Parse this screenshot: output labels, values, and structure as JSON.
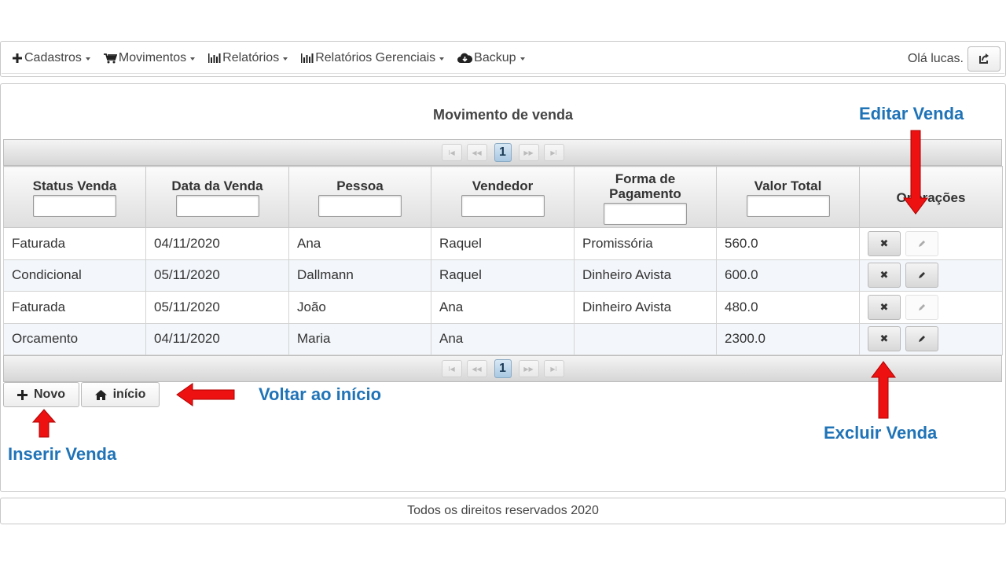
{
  "navbar": {
    "items": [
      {
        "label": "Cadastros",
        "icon": "plus-icon"
      },
      {
        "label": "Movimentos",
        "icon": "cart-icon"
      },
      {
        "label": "Relatórios",
        "icon": "bar-chart-icon"
      },
      {
        "label": "Relatórios Gerenciais",
        "icon": "bar-chart-icon"
      },
      {
        "label": "Backup",
        "icon": "cloud-download-icon"
      }
    ],
    "greeting": "Olá lucas.",
    "logout_icon": "share-exit-icon"
  },
  "page": {
    "title": "Movimento de venda"
  },
  "table": {
    "paginator": {
      "current_page": "1"
    },
    "columns": [
      "Status Venda",
      "Data da Venda",
      "Pessoa",
      "Vendedor",
      "Forma de Pagamento",
      "Valor Total",
      "Operações"
    ],
    "rows": [
      {
        "status": "Faturada",
        "date": "04/11/2020",
        "person": "Ana",
        "seller": "Raquel",
        "payment": "Promissória",
        "total": "560.0",
        "edit_enabled": false
      },
      {
        "status": "Condicional",
        "date": "05/11/2020",
        "person": "Dallmann",
        "seller": "Raquel",
        "payment": "Dinheiro Avista",
        "total": "600.0",
        "edit_enabled": true
      },
      {
        "status": "Faturada",
        "date": "05/11/2020",
        "person": "João",
        "seller": "Ana",
        "payment": "Dinheiro Avista",
        "total": "480.0",
        "edit_enabled": false
      },
      {
        "status": "Orcamento",
        "date": "04/11/2020",
        "person": "Maria",
        "seller": "Ana",
        "payment": "",
        "total": "2300.0",
        "edit_enabled": true
      }
    ],
    "delete_symbol": "✖"
  },
  "actions": {
    "new_label": "Novo",
    "home_label": "início"
  },
  "annotations": {
    "edit": "Editar Venda",
    "delete": "Excluir Venda",
    "back_home": "Voltar ao início",
    "insert": "Inserir Venda"
  },
  "footer": {
    "text": "Todos os direitos reservados 2020"
  },
  "colors": {
    "annotation_text": "#1f73b7",
    "arrow": "#ee1111"
  }
}
